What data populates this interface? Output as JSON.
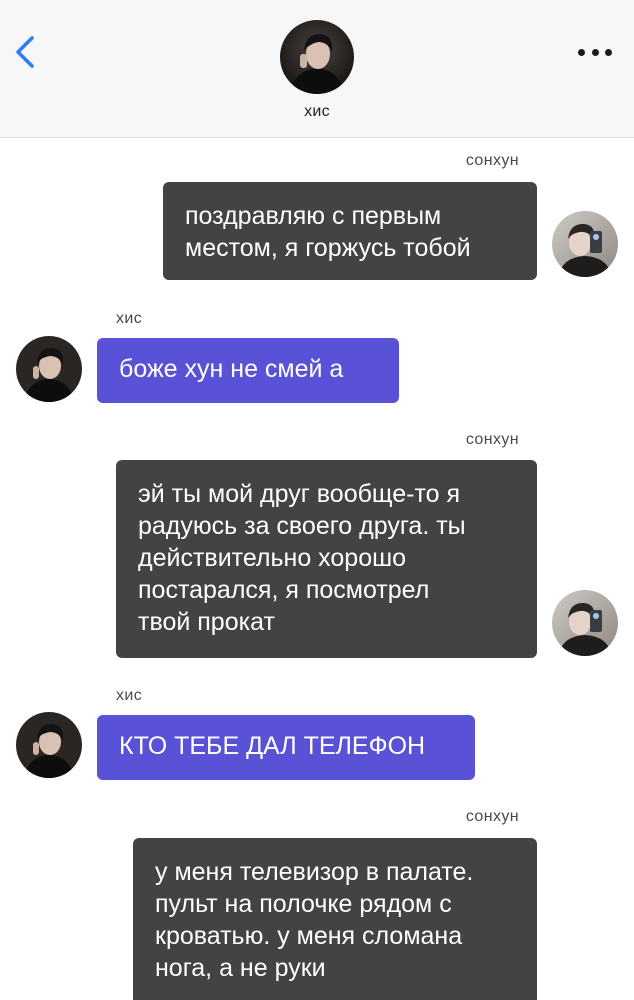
{
  "header": {
    "contact_name": "хис",
    "back_icon": "chevron-left-icon",
    "more_icon": "more-dots-icon"
  },
  "colors": {
    "header_bg": "#f7f7f7",
    "outgoing_bubble": "#434343",
    "incoming_bubble": "#5a52d6",
    "back_accent": "#2f7bf6"
  },
  "messages": [
    {
      "sender": "сонхун",
      "direction": "outgoing",
      "text": "поздравляю с первым\nместом, я горжусь тобой"
    },
    {
      "sender": "хис",
      "direction": "incoming",
      "text": "боже хун не смей а"
    },
    {
      "sender": "сонхун",
      "direction": "outgoing",
      "text": "эй ты мой друг вообще-то я\nрадуюсь за своего друга. ты\nдействительно хорошо\nпостарался, я посмотрел\nтвой прокат"
    },
    {
      "sender": "хис",
      "direction": "incoming",
      "text": "КТО ТЕБЕ ДАЛ ТЕЛЕФОН"
    },
    {
      "sender": "сонхун",
      "direction": "outgoing",
      "text": "у меня телевизор в палате.\nпульт на полочке рядом с\nкроватью. у меня сломана\nнога, а не руки"
    }
  ]
}
